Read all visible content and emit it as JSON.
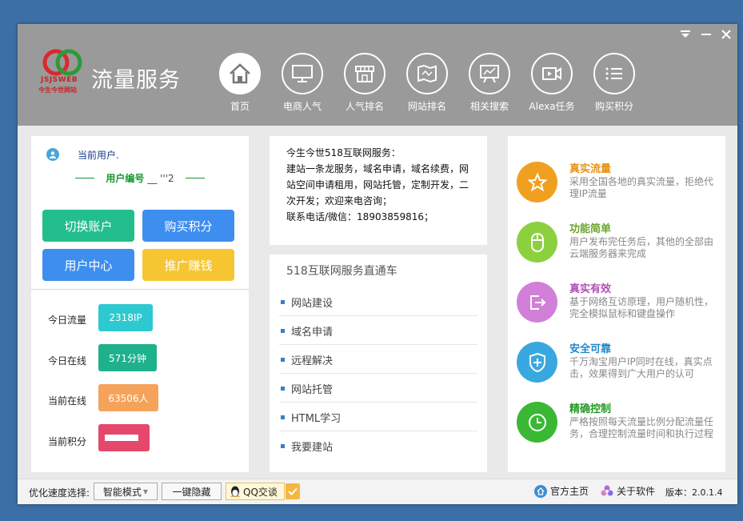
{
  "app": {
    "title": "流量服务",
    "logo_text": "JSJSWEB",
    "logo_sub": "今生今世网站"
  },
  "nav": [
    {
      "label": "首页",
      "icon": "home-icon"
    },
    {
      "label": "电商人气",
      "icon": "monitor-icon"
    },
    {
      "label": "人气排名",
      "icon": "store-icon"
    },
    {
      "label": "网站排名",
      "icon": "map-icon"
    },
    {
      "label": "相关搜索",
      "icon": "presentation-icon"
    },
    {
      "label": "Alexa任务",
      "icon": "video-icon"
    },
    {
      "label": "购买积分",
      "icon": "list-icon"
    }
  ],
  "user": {
    "current_user_label": "当前用户.",
    "user_id_label": "用户编号",
    "user_id_value": "__ '''2",
    "buttons": {
      "switch": "切换账户",
      "buy": "购买积分",
      "center": "用户中心",
      "promote": "推广赚钱"
    },
    "stats": [
      {
        "label": "今日流量",
        "value": "2318IP",
        "color": "#2ec9d0"
      },
      {
        "label": "今日在线",
        "value": "571分钟",
        "color": "#1fb08c"
      },
      {
        "label": "当前在线",
        "value": "63506人",
        "color": "#f5a35a"
      },
      {
        "label": "当前积分",
        "value": "",
        "color": "#e5486b"
      }
    ]
  },
  "notice": {
    "line1": "今生今世518互联网服务：",
    "line2": "建站一条龙服务，域名申请，域名续费，网",
    "line3": "站空间申请租用，网站托管，定制开发，二",
    "line4": "次开发；欢迎来电咨询；",
    "line5": "联系电话/微信：18903859816；"
  },
  "services": {
    "title": "518互联网服务直通车",
    "items": [
      "网站建设",
      "域名申请",
      "远程解决",
      "网站托管",
      "HTML学习",
      "我要建站"
    ]
  },
  "features": [
    {
      "title": "真实流量",
      "desc": "采用全国各地的真实流量，拒绝代理IP流量",
      "color": "#f0a020",
      "title_color": "#e8921a",
      "icon": "star-icon"
    },
    {
      "title": "功能简单",
      "desc": "用户发布完任务后，其他的全部由云端服务器来完成",
      "color": "#8cd040",
      "title_color": "#6aa52a",
      "icon": "mouse-icon"
    },
    {
      "title": "真实有效",
      "desc": "基于网络互访原理，用户随机性，完全模拟鼠标和键盘操作",
      "color": "#d27fd9",
      "title_color": "#b24fb8",
      "icon": "exit-icon"
    },
    {
      "title": "安全可靠",
      "desc": "千万淘宝用户IP同时在线，真实点击，效果得到广大用户的认可",
      "color": "#3aa8e0",
      "title_color": "#2288c9",
      "icon": "shield-plus-icon"
    },
    {
      "title": "精确控制",
      "desc": "严格按照每天流量比例分配流量任务，合理控制流量时间和执行过程",
      "color": "#3ab834",
      "title_color": "#259922",
      "icon": "clock-icon"
    }
  ],
  "footer": {
    "speed_label": "优化速度选择:",
    "mode": "智能模式",
    "hide_button": "一键隐藏",
    "qq_button": "QQ交谈",
    "homepage": "官方主页",
    "about": "关于软件",
    "version": "版本：2.0.1.4"
  }
}
